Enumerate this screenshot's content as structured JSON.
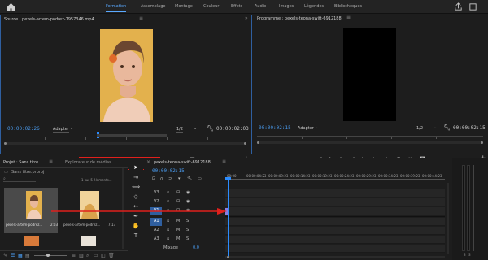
{
  "top_nav": {
    "tabs": [
      "Formation",
      "Assemblage",
      "Montage",
      "Couleur",
      "Effets",
      "Audio",
      "Images",
      "Légendes",
      "Bibliothèques"
    ],
    "active": "Formation"
  },
  "source": {
    "title": "Source : pexels-artem-podrez-7957346.mp4",
    "timecode_left": "00:00:02:26",
    "fit": "Adapter",
    "resolution": "1/2",
    "timecode_right": "00:00:02:03"
  },
  "program": {
    "title": "Programme : pexels-teona-swift-6912188",
    "timecode_left": "00:00:02:15",
    "fit": "Adapter",
    "resolution": "1/2",
    "timecode_right": "00:00:02:15"
  },
  "project": {
    "tab_active": "Projet : Sans titre",
    "tab_other": "Explorateur de médias",
    "project_file": "Sans titre.prproj",
    "selection_info": "1 sur 5 éléments...",
    "items": [
      {
        "name": "pexels-artem-podrez...",
        "duration": "2:03"
      },
      {
        "name": "pexels-artem-podrez...",
        "duration": "7:13"
      }
    ]
  },
  "timeline": {
    "tab": "pexels-teona-swift-6912188",
    "timecode": "00:00:02:15",
    "ruler": [
      "00:00",
      "00:00:04:23",
      "00:00:09:23",
      "00:00:14:23",
      "00:00:19:23",
      "00:00:24:23",
      "00:00:29:23",
      "00:00:34:23",
      "00:00:39:23",
      "00:00:44:23"
    ],
    "video_tracks": [
      "V3",
      "V2",
      "V1"
    ],
    "audio_tracks": [
      "A1",
      "A2",
      "A3"
    ],
    "mix_label": "Mixage",
    "mix_value": "0,0",
    "solo_mute": [
      "M",
      "S"
    ]
  },
  "colors": {
    "accent": "#4a9cf0",
    "annotation": "#e0201c",
    "playhead": "#2b8cff",
    "clip": "#8c7ce0"
  }
}
